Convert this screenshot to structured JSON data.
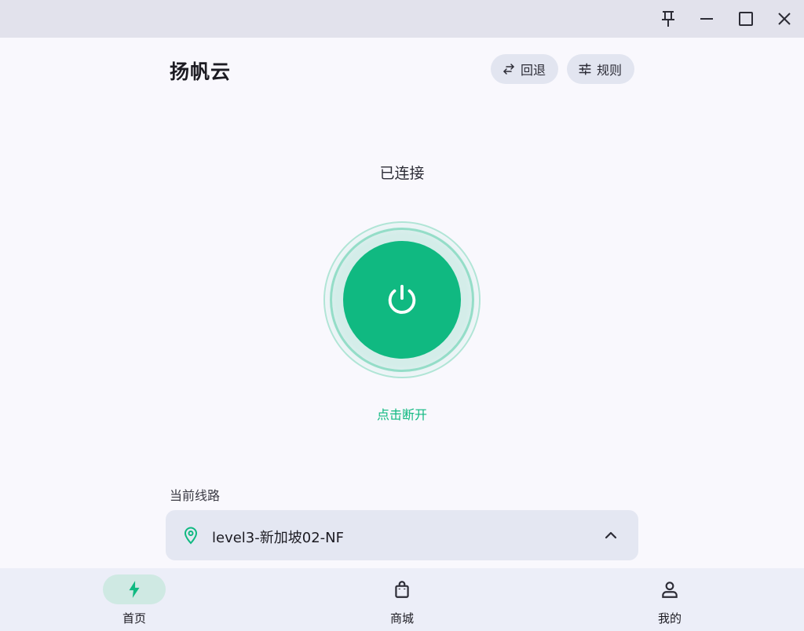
{
  "window": {
    "controls": [
      "pin-icon",
      "minimize-icon",
      "maximize-icon",
      "close-icon"
    ]
  },
  "header": {
    "title": "扬帆云",
    "rollback_label": "回退",
    "rules_label": "规则"
  },
  "connection": {
    "status": "已连接",
    "action_label": "点击断开",
    "accent_color": "#10b981"
  },
  "route": {
    "label": "当前线路",
    "current": "level3-新加坡02-NF"
  },
  "bottom_nav": {
    "items": [
      {
        "label": "首页",
        "icon": "lightning-icon",
        "active": true
      },
      {
        "label": "商城",
        "icon": "shopping-bag-icon",
        "active": false
      },
      {
        "label": "我的",
        "icon": "user-icon",
        "active": false
      }
    ]
  }
}
